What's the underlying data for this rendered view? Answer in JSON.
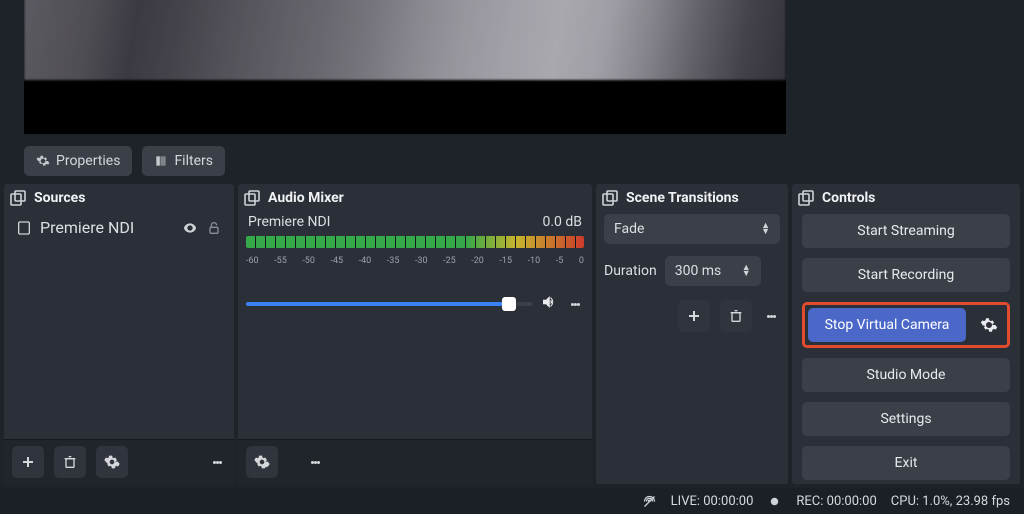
{
  "toolbar": {
    "properties": "Properties",
    "filters": "Filters"
  },
  "sources": {
    "title": "Sources",
    "items": [
      {
        "name": "Premiere NDI"
      }
    ]
  },
  "mixer": {
    "title": "Audio Mixer",
    "channel_name": "Premiere NDI",
    "level": "0.0 dB",
    "ticks": [
      "-60",
      "-55",
      "-50",
      "-45",
      "-40",
      "-35",
      "-30",
      "-25",
      "-20",
      "-15",
      "-10",
      "-5",
      "0"
    ]
  },
  "transitions": {
    "title": "Scene Transitions",
    "current": "Fade",
    "duration_label": "Duration",
    "duration_value": "300 ms"
  },
  "controls": {
    "title": "Controls",
    "start_streaming": "Start Streaming",
    "start_recording": "Start Recording",
    "stop_virtual_camera": "Stop Virtual Camera",
    "studio_mode": "Studio Mode",
    "settings": "Settings",
    "exit": "Exit"
  },
  "status": {
    "live_label": "LIVE:",
    "live_time": "00:00:00",
    "rec_label": "REC:",
    "rec_time": "00:00:00",
    "perf": "CPU: 1.0%, 23.98 fps"
  }
}
